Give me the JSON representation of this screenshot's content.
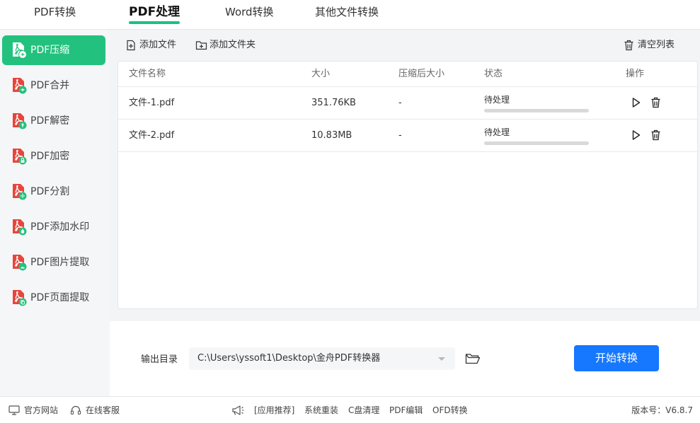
{
  "topnav": {
    "tabs": [
      {
        "label": "PDF转换",
        "active": false
      },
      {
        "label": "PDF处理",
        "active": true
      },
      {
        "label": "Word转换",
        "active": false
      },
      {
        "label": "其他文件转换",
        "active": false
      }
    ]
  },
  "sidebar": {
    "items": [
      {
        "label": "PDF压缩",
        "active": true,
        "icon": "pdf-compress-icon"
      },
      {
        "label": "PDF合并",
        "active": false,
        "icon": "pdf-merge-icon"
      },
      {
        "label": "PDF解密",
        "active": false,
        "icon": "pdf-decrypt-icon"
      },
      {
        "label": "PDF加密",
        "active": false,
        "icon": "pdf-encrypt-icon"
      },
      {
        "label": "PDF分割",
        "active": false,
        "icon": "pdf-split-icon"
      },
      {
        "label": "PDF添加水印",
        "active": false,
        "icon": "pdf-watermark-icon"
      },
      {
        "label": "PDF图片提取",
        "active": false,
        "icon": "pdf-image-extract-icon"
      },
      {
        "label": "PDF页面提取",
        "active": false,
        "icon": "pdf-page-extract-icon"
      }
    ]
  },
  "toolbar": {
    "add_file": "添加文件",
    "add_folder": "添加文件夹",
    "clear_list": "清空列表"
  },
  "table": {
    "columns": [
      "文件名称",
      "大小",
      "压缩后大小",
      "状态",
      "操作"
    ],
    "rows": [
      {
        "name": "文件-1.pdf",
        "size": "351.76KB",
        "compressed": "-",
        "status": "待处理",
        "progress": 0
      },
      {
        "name": "文件-2.pdf",
        "size": "10.83MB",
        "compressed": "-",
        "status": "待处理",
        "progress": 0
      }
    ]
  },
  "output": {
    "label": "输出目录",
    "path": "C:\\Users\\yssoft1\\Desktop\\金舟PDF转换器",
    "start_button": "开始转换"
  },
  "footer": {
    "website": "官方网站",
    "support": "在线客服",
    "recommend": "[应用推荐]",
    "links": [
      "系统重装",
      "C盘清理",
      "PDF编辑",
      "OFD转换"
    ],
    "version": "版本号：V6.8.7"
  },
  "colors": {
    "accent_green": "#22c27e",
    "primary_blue": "#1677ff",
    "pdf_red": "#e8453c"
  }
}
